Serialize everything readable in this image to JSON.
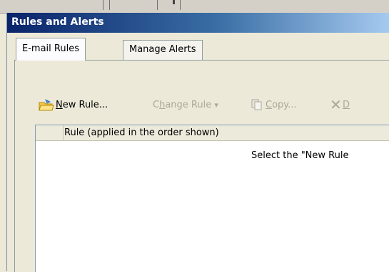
{
  "window": {
    "title": "Rules and Alerts"
  },
  "tabs": [
    {
      "label": "E-mail Rules",
      "active": true
    },
    {
      "label": "Manage Alerts",
      "active": false
    }
  ],
  "toolbar": {
    "new_rule": {
      "mnemonic": "N",
      "rest": "ew Rule...",
      "icon": "new-rule-icon",
      "enabled": true
    },
    "change_rule": {
      "pre": "C",
      "mnemonic": "h",
      "rest": "ange Rule",
      "dropdown": "▾",
      "enabled": false
    },
    "copy": {
      "mnemonic": "C",
      "rest": "opy...",
      "icon": "copy-icon",
      "enabled": false
    },
    "delete": {
      "mnemonic": "D",
      "icon": "delete-icon",
      "enabled": false
    }
  },
  "rules_list": {
    "column_header": "Rule (applied in the order shown)",
    "empty_message": "Select the \"New Rule"
  },
  "colors": {
    "title_gradient_start": "#0a246a",
    "title_gradient_end": "#a6caf0",
    "disabled_text": "#aca899",
    "dialog_bg": "#ece9d8"
  }
}
